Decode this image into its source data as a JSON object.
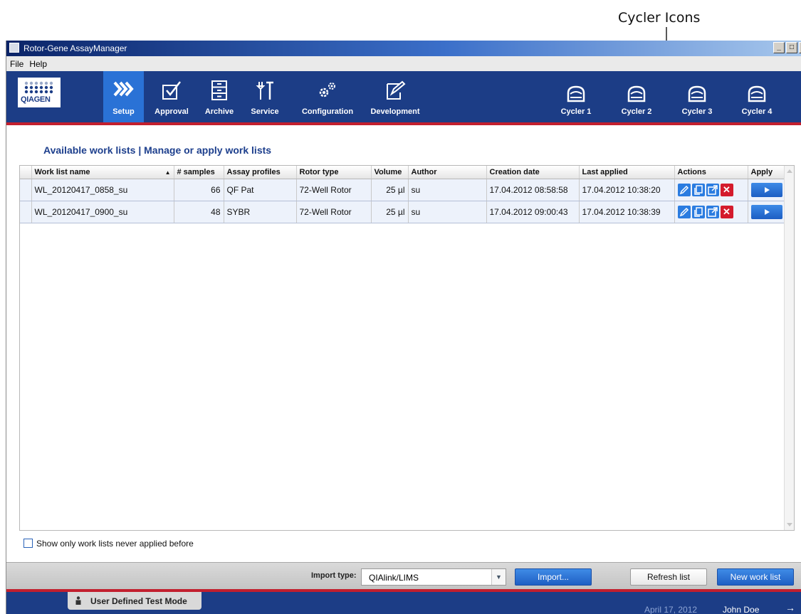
{
  "annotation": {
    "label": "Cycler Icons"
  },
  "window": {
    "title": "Rotor-Gene AssayManager"
  },
  "menu": {
    "items": [
      "File",
      "Help"
    ]
  },
  "logo": {
    "text": "QIAGEN"
  },
  "nav": {
    "items": [
      {
        "label": "Setup",
        "icon": "setup-chevrons-icon",
        "active": true
      },
      {
        "label": "Approval",
        "icon": "approval-check-icon"
      },
      {
        "label": "Archive",
        "icon": "archive-cabinet-icon"
      },
      {
        "label": "Service",
        "icon": "service-tools-icon"
      },
      {
        "label": "Configuration",
        "icon": "configuration-gears-icon"
      },
      {
        "label": "Development",
        "icon": "development-icon"
      }
    ],
    "cyclers": [
      {
        "label": "Cycler 1",
        "icon": "cycler-icon"
      },
      {
        "label": "Cycler 2",
        "icon": "cycler-icon"
      },
      {
        "label": "Cycler 3",
        "icon": "cycler-icon"
      },
      {
        "label": "Cycler 4",
        "icon": "cycler-icon"
      }
    ]
  },
  "content": {
    "title": "Available work lists | Manage or apply work lists"
  },
  "table": {
    "columns": [
      "Work list name",
      "# samples",
      "Assay profiles",
      "Rotor type",
      "Volume",
      "Author",
      "Creation date",
      "Last applied",
      "Actions",
      "Apply"
    ],
    "rows": [
      {
        "name": "WL_20120417_0858_su",
        "samples": "66",
        "assay": "QF Pat",
        "rotor": "72-Well Rotor",
        "volume": "25 µl",
        "author": "su",
        "created": "17.04.2012 08:58:58",
        "applied": "17.04.2012 10:38:20"
      },
      {
        "name": "WL_20120417_0900_su",
        "samples": "48",
        "assay": "SYBR",
        "rotor": "72-Well Rotor",
        "volume": "25 µl",
        "author": "su",
        "created": "17.04.2012 09:00:43",
        "applied": "17.04.2012 10:38:39"
      }
    ],
    "action_icons": [
      "edit-icon",
      "copy-icon",
      "export-icon",
      "delete-icon"
    ],
    "apply_icon": "play-icon"
  },
  "filter": {
    "label": "Show only work lists never applied before",
    "checked": false
  },
  "bottombar": {
    "import_label": "Import type:",
    "import_value": "QIAlink/LIMS",
    "import_button": "Import...",
    "refresh_button": "Refresh list",
    "new_button": "New work list"
  },
  "statusbar": {
    "mode": "User Defined Test Mode",
    "date": "April 17, 2012",
    "user": "John Doe"
  },
  "colors": {
    "navbar": "#1c3d86",
    "accent_red": "#c21f2e",
    "active_tab": "#2a72d6",
    "title_blue": "#1d3f8d"
  }
}
